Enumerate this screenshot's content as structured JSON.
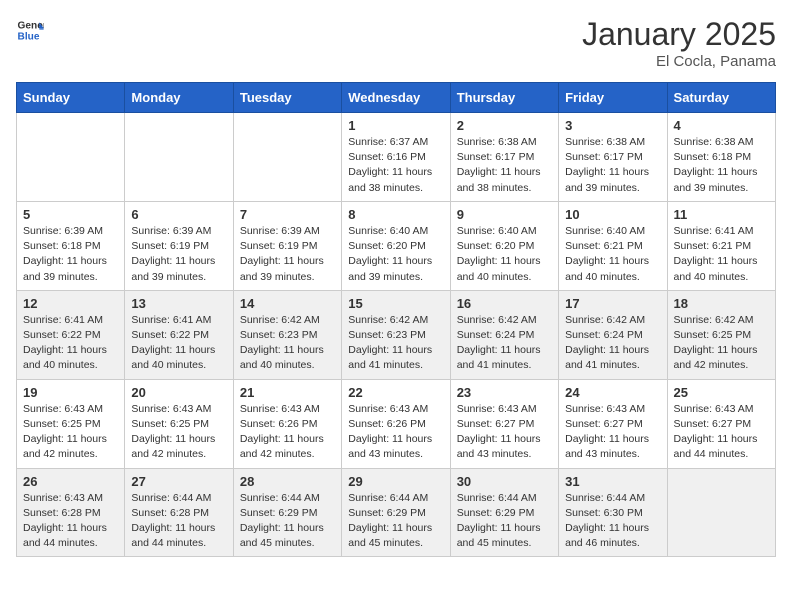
{
  "header": {
    "logo_general": "General",
    "logo_blue": "Blue",
    "month_year": "January 2025",
    "location": "El Cocla, Panama"
  },
  "days_of_week": [
    "Sunday",
    "Monday",
    "Tuesday",
    "Wednesday",
    "Thursday",
    "Friday",
    "Saturday"
  ],
  "weeks": [
    [
      {
        "day": "",
        "info": ""
      },
      {
        "day": "",
        "info": ""
      },
      {
        "day": "",
        "info": ""
      },
      {
        "day": "1",
        "info": "Sunrise: 6:37 AM\nSunset: 6:16 PM\nDaylight: 11 hours and 38 minutes."
      },
      {
        "day": "2",
        "info": "Sunrise: 6:38 AM\nSunset: 6:17 PM\nDaylight: 11 hours and 38 minutes."
      },
      {
        "day": "3",
        "info": "Sunrise: 6:38 AM\nSunset: 6:17 PM\nDaylight: 11 hours and 39 minutes."
      },
      {
        "day": "4",
        "info": "Sunrise: 6:38 AM\nSunset: 6:18 PM\nDaylight: 11 hours and 39 minutes."
      }
    ],
    [
      {
        "day": "5",
        "info": "Sunrise: 6:39 AM\nSunset: 6:18 PM\nDaylight: 11 hours and 39 minutes."
      },
      {
        "day": "6",
        "info": "Sunrise: 6:39 AM\nSunset: 6:19 PM\nDaylight: 11 hours and 39 minutes."
      },
      {
        "day": "7",
        "info": "Sunrise: 6:39 AM\nSunset: 6:19 PM\nDaylight: 11 hours and 39 minutes."
      },
      {
        "day": "8",
        "info": "Sunrise: 6:40 AM\nSunset: 6:20 PM\nDaylight: 11 hours and 39 minutes."
      },
      {
        "day": "9",
        "info": "Sunrise: 6:40 AM\nSunset: 6:20 PM\nDaylight: 11 hours and 40 minutes."
      },
      {
        "day": "10",
        "info": "Sunrise: 6:40 AM\nSunset: 6:21 PM\nDaylight: 11 hours and 40 minutes."
      },
      {
        "day": "11",
        "info": "Sunrise: 6:41 AM\nSunset: 6:21 PM\nDaylight: 11 hours and 40 minutes."
      }
    ],
    [
      {
        "day": "12",
        "info": "Sunrise: 6:41 AM\nSunset: 6:22 PM\nDaylight: 11 hours and 40 minutes."
      },
      {
        "day": "13",
        "info": "Sunrise: 6:41 AM\nSunset: 6:22 PM\nDaylight: 11 hours and 40 minutes."
      },
      {
        "day": "14",
        "info": "Sunrise: 6:42 AM\nSunset: 6:23 PM\nDaylight: 11 hours and 40 minutes."
      },
      {
        "day": "15",
        "info": "Sunrise: 6:42 AM\nSunset: 6:23 PM\nDaylight: 11 hours and 41 minutes."
      },
      {
        "day": "16",
        "info": "Sunrise: 6:42 AM\nSunset: 6:24 PM\nDaylight: 11 hours and 41 minutes."
      },
      {
        "day": "17",
        "info": "Sunrise: 6:42 AM\nSunset: 6:24 PM\nDaylight: 11 hours and 41 minutes."
      },
      {
        "day": "18",
        "info": "Sunrise: 6:42 AM\nSunset: 6:25 PM\nDaylight: 11 hours and 42 minutes."
      }
    ],
    [
      {
        "day": "19",
        "info": "Sunrise: 6:43 AM\nSunset: 6:25 PM\nDaylight: 11 hours and 42 minutes."
      },
      {
        "day": "20",
        "info": "Sunrise: 6:43 AM\nSunset: 6:25 PM\nDaylight: 11 hours and 42 minutes."
      },
      {
        "day": "21",
        "info": "Sunrise: 6:43 AM\nSunset: 6:26 PM\nDaylight: 11 hours and 42 minutes."
      },
      {
        "day": "22",
        "info": "Sunrise: 6:43 AM\nSunset: 6:26 PM\nDaylight: 11 hours and 43 minutes."
      },
      {
        "day": "23",
        "info": "Sunrise: 6:43 AM\nSunset: 6:27 PM\nDaylight: 11 hours and 43 minutes."
      },
      {
        "day": "24",
        "info": "Sunrise: 6:43 AM\nSunset: 6:27 PM\nDaylight: 11 hours and 43 minutes."
      },
      {
        "day": "25",
        "info": "Sunrise: 6:43 AM\nSunset: 6:27 PM\nDaylight: 11 hours and 44 minutes."
      }
    ],
    [
      {
        "day": "26",
        "info": "Sunrise: 6:43 AM\nSunset: 6:28 PM\nDaylight: 11 hours and 44 minutes."
      },
      {
        "day": "27",
        "info": "Sunrise: 6:44 AM\nSunset: 6:28 PM\nDaylight: 11 hours and 44 minutes."
      },
      {
        "day": "28",
        "info": "Sunrise: 6:44 AM\nSunset: 6:29 PM\nDaylight: 11 hours and 45 minutes."
      },
      {
        "day": "29",
        "info": "Sunrise: 6:44 AM\nSunset: 6:29 PM\nDaylight: 11 hours and 45 minutes."
      },
      {
        "day": "30",
        "info": "Sunrise: 6:44 AM\nSunset: 6:29 PM\nDaylight: 11 hours and 45 minutes."
      },
      {
        "day": "31",
        "info": "Sunrise: 6:44 AM\nSunset: 6:30 PM\nDaylight: 11 hours and 46 minutes."
      },
      {
        "day": "",
        "info": ""
      }
    ]
  ]
}
